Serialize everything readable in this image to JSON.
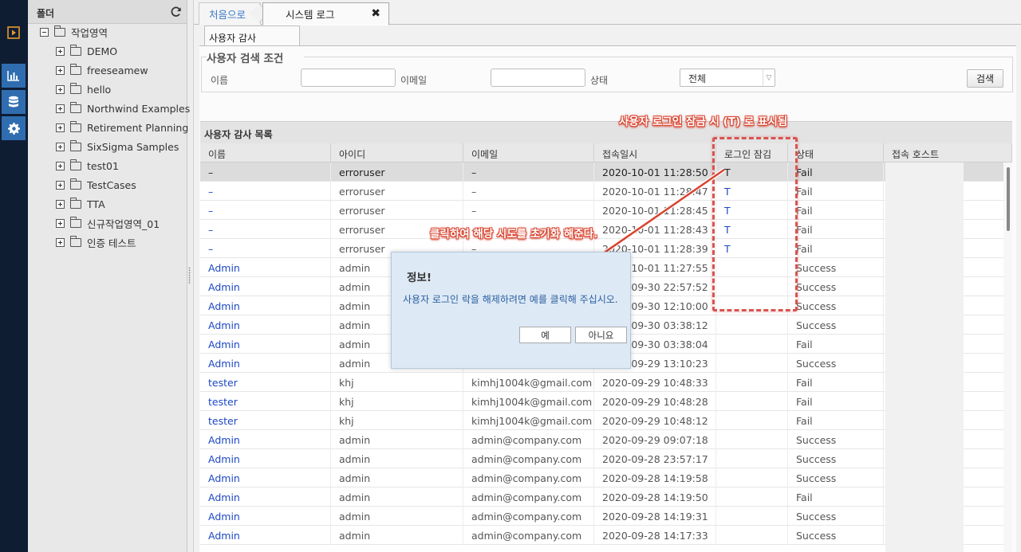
{
  "sidebar": {
    "items": [
      {
        "icon": "play-square-icon"
      },
      {
        "icon": "bar-chart-icon"
      },
      {
        "icon": "database-icon"
      },
      {
        "icon": "gear-icon"
      }
    ]
  },
  "folder_panel": {
    "title": "폴더",
    "refresh_icon": "refresh-icon",
    "root": "작업영역",
    "children": [
      "DEMO",
      "freeseamew",
      "hello",
      "Northwind Examples",
      "Retirement Planning",
      "SixSigma Samples",
      "test01",
      "TestCases",
      "TTA",
      "신규작업영역_01",
      "인증 테스트"
    ]
  },
  "tabs": {
    "home": "처음으로",
    "active": "시스템 로그",
    "close": "✖",
    "sub": "사용자 감사"
  },
  "search": {
    "title": "사용자 검색 조건",
    "name_label": "이름",
    "email_label": "이메일",
    "status_label": "상태",
    "status_value": "전체",
    "button": "검색"
  },
  "list": {
    "title": "사용자 감사 목록",
    "columns": [
      "이름",
      "아이디",
      "이메일",
      "접속일시",
      "로그인 잠김",
      "상태",
      "접속 호스트"
    ],
    "rows": [
      {
        "name": "–",
        "id": "erroruser",
        "email": "–",
        "time": "2020-10-01 11:28:50",
        "lock": "T",
        "status": "Fail"
      },
      {
        "name": "–",
        "id": "erroruser",
        "email": "–",
        "time": "2020-10-01 11:28:47",
        "lock": "T",
        "status": "Fail"
      },
      {
        "name": "–",
        "id": "erroruser",
        "email": "–",
        "time": "2020-10-01 11:28:45",
        "lock": "T",
        "status": "Fail"
      },
      {
        "name": "–",
        "id": "erroruser",
        "email": "–",
        "time": "2020-10-01 11:28:43",
        "lock": "T",
        "status": "Fail"
      },
      {
        "name": "–",
        "id": "erroruser",
        "email": "–",
        "time": "2020-10-01 11:28:39",
        "lock": "T",
        "status": "Fail"
      },
      {
        "name": "Admin",
        "id": "admin",
        "email": "",
        "time": "2020-10-01 11:27:55",
        "lock": "",
        "status": "Success"
      },
      {
        "name": "Admin",
        "id": "admin",
        "email": "",
        "time": "2020-09-30 22:57:52",
        "lock": "",
        "status": "Success"
      },
      {
        "name": "Admin",
        "id": "admin",
        "email": "",
        "time": "2020-09-30 12:10:00",
        "lock": "",
        "status": "Success"
      },
      {
        "name": "Admin",
        "id": "admin",
        "email": "",
        "time": "2020-09-30 03:38:12",
        "lock": "",
        "status": "Success"
      },
      {
        "name": "Admin",
        "id": "admin",
        "email": "",
        "time": "2020-09-30 03:38:04",
        "lock": "",
        "status": "Fail"
      },
      {
        "name": "Admin",
        "id": "admin",
        "email": "",
        "time": "2020-09-29 13:10:23",
        "lock": "",
        "status": "Success"
      },
      {
        "name": "tester",
        "id": "khj",
        "email": "kimhj1004k@gmail.com",
        "time": "2020-09-29 10:48:33",
        "lock": "",
        "status": "Fail"
      },
      {
        "name": "tester",
        "id": "khj",
        "email": "kimhj1004k@gmail.com",
        "time": "2020-09-29 10:48:28",
        "lock": "",
        "status": "Fail"
      },
      {
        "name": "tester",
        "id": "khj",
        "email": "kimhj1004k@gmail.com",
        "time": "2020-09-29 10:48:12",
        "lock": "",
        "status": "Fail"
      },
      {
        "name": "Admin",
        "id": "admin",
        "email": "admin@company.com",
        "time": "2020-09-29 09:07:18",
        "lock": "",
        "status": "Success"
      },
      {
        "name": "Admin",
        "id": "admin",
        "email": "admin@company.com",
        "time": "2020-09-28 23:57:17",
        "lock": "",
        "status": "Success"
      },
      {
        "name": "Admin",
        "id": "admin",
        "email": "admin@company.com",
        "time": "2020-09-28 14:19:58",
        "lock": "",
        "status": "Success"
      },
      {
        "name": "Admin",
        "id": "admin",
        "email": "admin@company.com",
        "time": "2020-09-28 14:19:50",
        "lock": "",
        "status": "Fail"
      },
      {
        "name": "Admin",
        "id": "admin",
        "email": "admin@company.com",
        "time": "2020-09-28 14:19:31",
        "lock": "",
        "status": "Success"
      },
      {
        "name": "Admin",
        "id": "admin",
        "email": "admin@company.com",
        "time": "2020-09-28 14:17:33",
        "lock": "",
        "status": "Success"
      }
    ]
  },
  "annotations": {
    "lock_note": "사용자 로그인 잠금 시 (T) 로 표시됨",
    "click_note": "클릭하여 해당 시도를 초기화 해준다."
  },
  "dialog": {
    "title": "정보!",
    "message": "사용자 로그인 락을 해제하려면 예를 클릭해 주십시오.",
    "yes": "예",
    "no": "아니요"
  },
  "colors": {
    "rail": "#0f1d33",
    "rail_active": "#2f6db0",
    "link_blue": "#1d48c4",
    "annotation_red": "#d9432f",
    "dialog_bg": "#dde9f5"
  }
}
